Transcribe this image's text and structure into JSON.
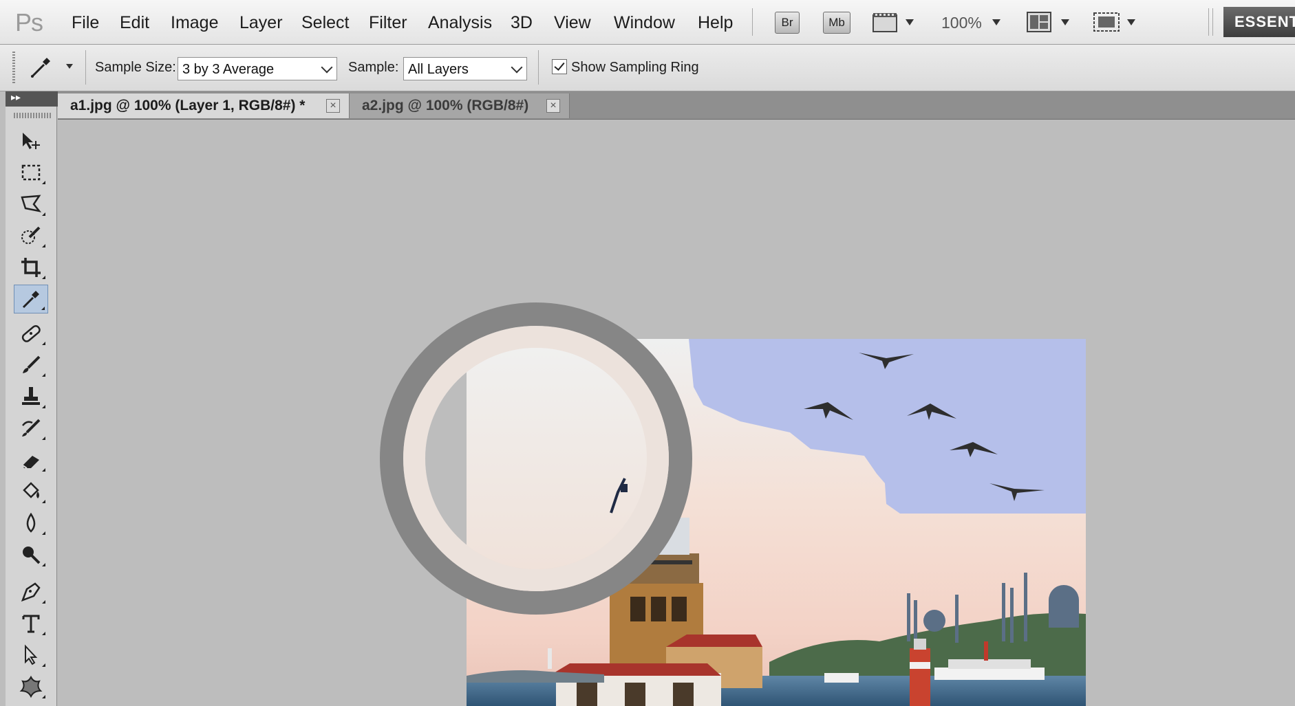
{
  "app": {
    "logo": "Ps",
    "menu": [
      "File",
      "Edit",
      "Image",
      "Layer",
      "Select",
      "Filter",
      "Analysis",
      "3D",
      "View",
      "Window",
      "Help"
    ],
    "bridge_label": "Br",
    "minibridge_label": "Mb",
    "zoom": "100%",
    "workspace": "ESSENT"
  },
  "options": {
    "sample_size_label": "Sample Size:",
    "sample_size_value": "3 by 3 Average",
    "sample_label": "Sample:",
    "sample_value": "All Layers",
    "show_sampling_ring_label": "Show Sampling Ring",
    "show_sampling_ring_checked": true
  },
  "tabs": [
    {
      "label": "a1.jpg @ 100% (Layer 1, RGB/8#) *",
      "active": true
    },
    {
      "label": "a2.jpg @ 100% (RGB/8#)",
      "active": false
    }
  ],
  "tools": [
    "move-tool",
    "rectangular-marquee-tool",
    "polygonal-lasso-tool",
    "quick-selection-tool",
    "crop-tool",
    "eyedropper-tool",
    "spot-healing-brush-tool",
    "brush-tool",
    "clone-stamp-tool",
    "history-brush-tool",
    "eraser-tool",
    "paint-bucket-tool",
    "blur-tool",
    "dodge-tool",
    "pen-tool",
    "type-tool",
    "path-selection-tool",
    "custom-shape-tool"
  ],
  "active_tool": "eyedropper-tool",
  "colors": {
    "sampling_ring_outer": "#868686",
    "sampling_ring_inner": "#ece2dc",
    "sky_patch": "#b5bfea",
    "sky_warm": "#f2ddd3"
  }
}
